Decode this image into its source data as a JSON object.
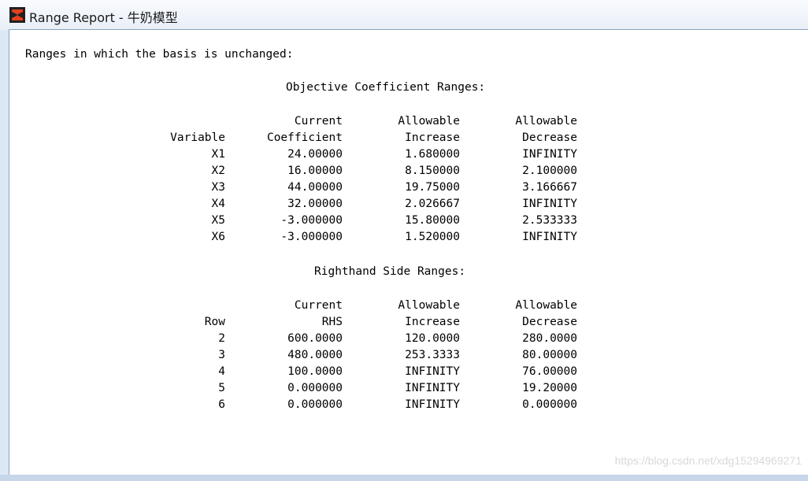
{
  "window": {
    "title": "Range Report - 牛奶模型",
    "icon": "lingo-app-icon"
  },
  "report": {
    "heading": "Ranges in which the basis is unchanged:",
    "objective": {
      "title": "Objective Coefficient Ranges:",
      "header1": [
        "",
        "Current",
        "Allowable",
        "Allowable"
      ],
      "header2": [
        "Variable",
        "Coefficient",
        "Increase",
        "Decrease"
      ],
      "rows": [
        [
          "X1",
          "24.00000",
          "1.680000",
          "INFINITY"
        ],
        [
          "X2",
          "16.00000",
          "8.150000",
          "2.100000"
        ],
        [
          "X3",
          "44.00000",
          "19.75000",
          "3.166667"
        ],
        [
          "X4",
          "32.00000",
          "2.026667",
          "INFINITY"
        ],
        [
          "X5",
          "-3.000000",
          "15.80000",
          "2.533333"
        ],
        [
          "X6",
          "-3.000000",
          "1.520000",
          "INFINITY"
        ]
      ]
    },
    "rhs": {
      "title": "Righthand Side Ranges:",
      "header1": [
        "",
        "Current",
        "Allowable",
        "Allowable"
      ],
      "header2": [
        "Row",
        "RHS",
        "Increase",
        "Decrease"
      ],
      "rows": [
        [
          "2",
          "600.0000",
          "120.0000",
          "280.0000"
        ],
        [
          "3",
          "480.0000",
          "253.3333",
          "80.00000"
        ],
        [
          "4",
          "100.0000",
          "INFINITY",
          "76.00000"
        ],
        [
          "5",
          "0.000000",
          "INFINITY",
          "19.20000"
        ],
        [
          "6",
          "0.000000",
          "INFINITY",
          "0.000000"
        ]
      ]
    }
  },
  "watermark": "https://blog.csdn.net/xdg15294969271"
}
